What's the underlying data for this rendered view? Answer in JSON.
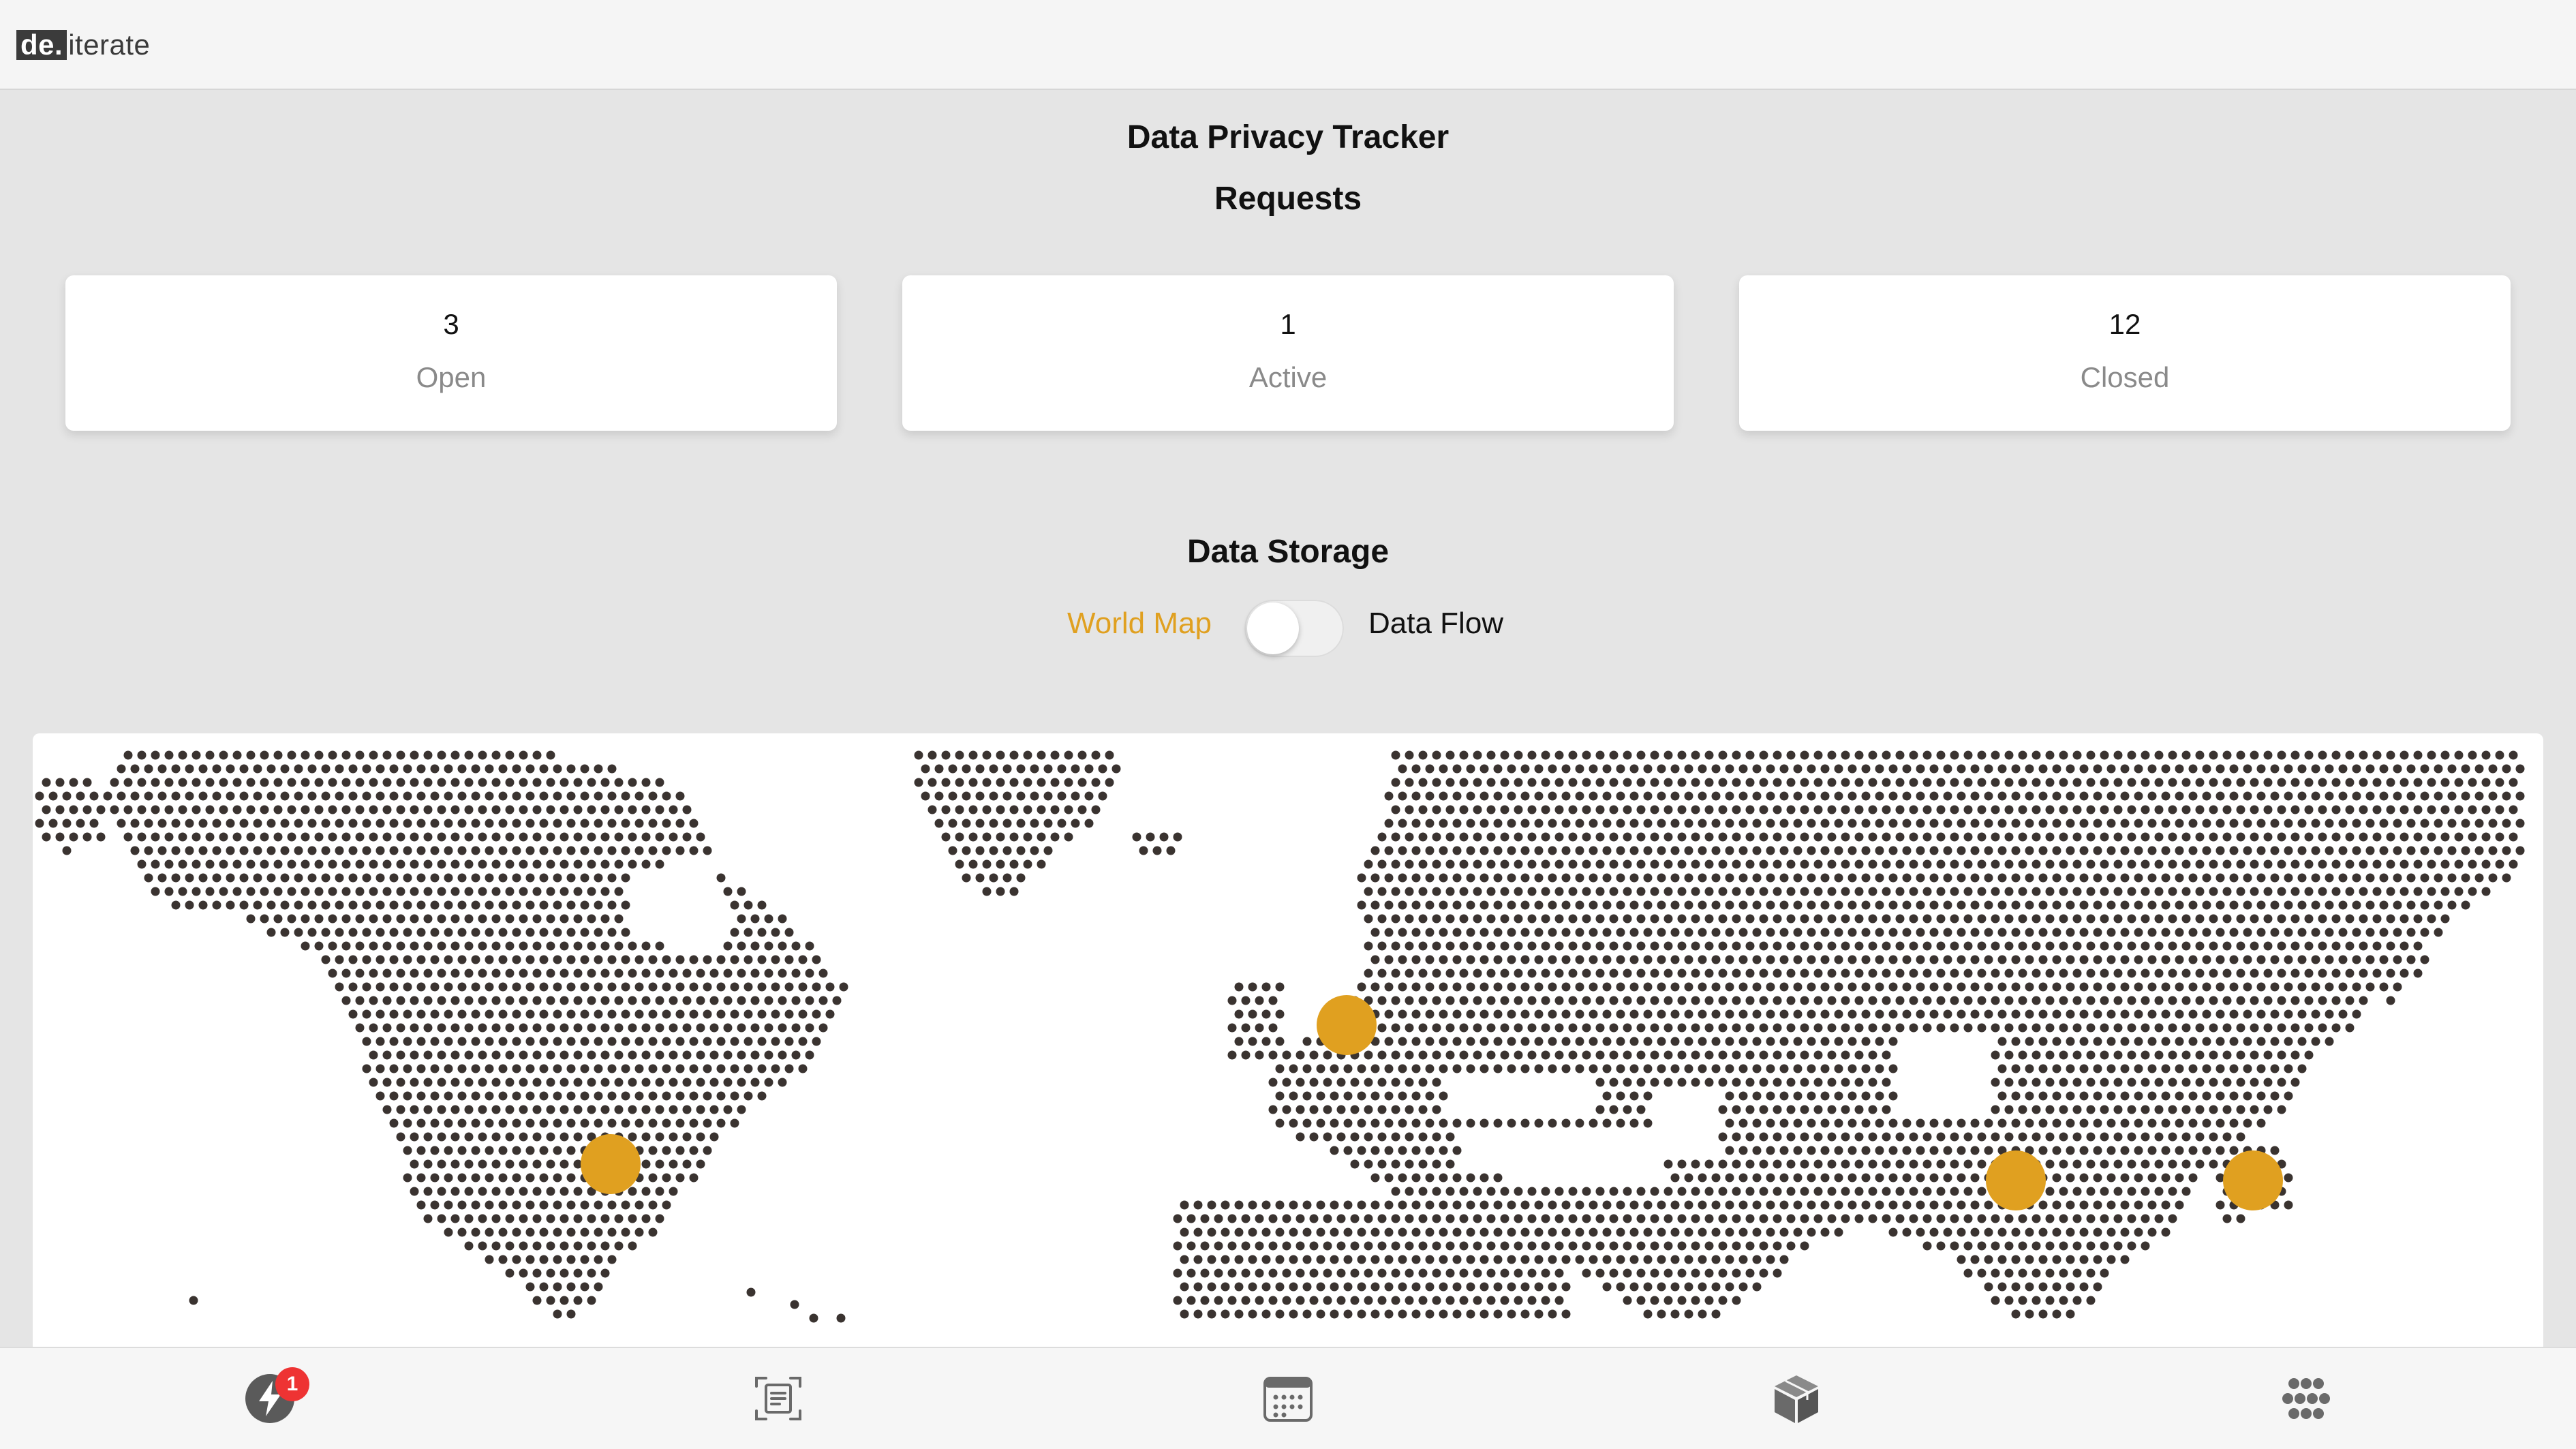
{
  "app": {
    "logo_prefix": "de.",
    "logo_suffix": "iterate",
    "title": "Data Privacy Tracker"
  },
  "requests": {
    "heading": "Requests",
    "cards": [
      {
        "count": "3",
        "label": "Open"
      },
      {
        "count": "1",
        "label": "Active"
      },
      {
        "count": "12",
        "label": "Closed"
      }
    ]
  },
  "storage": {
    "heading": "Data Storage",
    "toggle_left_label": "World Map",
    "toggle_right_label": "Data Flow",
    "toggle_on": false,
    "markers": [
      {
        "name": "North America"
      },
      {
        "name": "Europe"
      },
      {
        "name": "India"
      },
      {
        "name": "Southeast Asia"
      }
    ]
  },
  "colors": {
    "accent": "#e0a020",
    "dot": "#3a3330",
    "badge": "#ee3333"
  },
  "bottom_nav": {
    "items": [
      {
        "icon": "bolt-icon",
        "badge": "1"
      },
      {
        "icon": "scan-document-icon"
      },
      {
        "icon": "calendar-icon"
      },
      {
        "icon": "package-icon"
      },
      {
        "icon": "apps-grid-icon"
      }
    ]
  }
}
